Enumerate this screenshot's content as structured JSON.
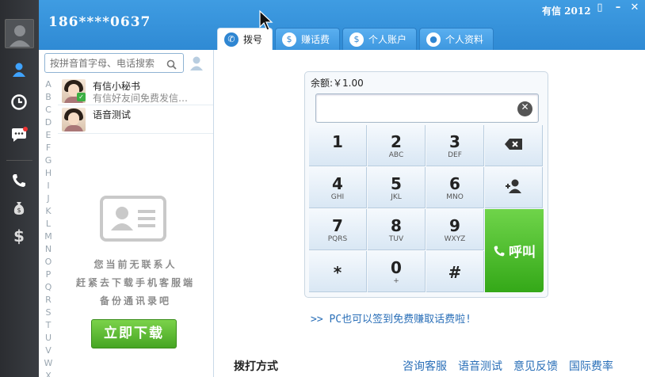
{
  "header": {
    "phone": "186****0637",
    "brand": "有信 2012"
  },
  "tabs": [
    {
      "label": "拨号",
      "icon": "phone-icon"
    },
    {
      "label": "赚话费",
      "icon": "money-bag-icon"
    },
    {
      "label": "个人账户",
      "icon": "dollar-icon"
    },
    {
      "label": "个人资料",
      "icon": "user-icon"
    }
  ],
  "sidebar_icons": [
    "contacts-icon",
    "history-icon",
    "message-icon",
    "call-icon",
    "money-bag-icon",
    "dollar-icon"
  ],
  "contacts": {
    "search_placeholder": "按拼音首字母、电话搜索",
    "alphabet": [
      "A",
      "B",
      "C",
      "D",
      "E",
      "F",
      "G",
      "H",
      "I",
      "J",
      "K",
      "L",
      "M",
      "N",
      "O",
      "P",
      "Q",
      "R",
      "S",
      "T",
      "U",
      "V",
      "W",
      "X"
    ],
    "items": [
      {
        "name": "有信小秘书",
        "desc": "有信好友间免费发信…"
      },
      {
        "name": "语音测试",
        "desc": ""
      }
    ],
    "empty_lines": [
      "您当前无联系人",
      "赶紧去下载手机客服端",
      "备份通讯录吧"
    ],
    "download_label": "立即下载"
  },
  "dialer": {
    "balance": "余额:￥1.00",
    "number_value": "",
    "keys": [
      {
        "digit": "1",
        "letters": ""
      },
      {
        "digit": "2",
        "letters": "ABC"
      },
      {
        "digit": "3",
        "letters": "DEF"
      },
      {
        "digit": "4",
        "letters": "GHI"
      },
      {
        "digit": "5",
        "letters": "JKL"
      },
      {
        "digit": "6",
        "letters": "MNO"
      },
      {
        "digit": "7",
        "letters": "PQRS"
      },
      {
        "digit": "8",
        "letters": "TUV"
      },
      {
        "digit": "9",
        "letters": "WXYZ"
      },
      {
        "digit": "*",
        "letters": ""
      },
      {
        "digit": "0",
        "letters": "+"
      },
      {
        "digit": "#",
        "letters": ""
      }
    ],
    "call_label": "呼叫",
    "promo": ">> PC也可以签到免费赚取话费啦!"
  },
  "footer": {
    "title": "拨打方式",
    "links": [
      "咨询客服",
      "语音测试",
      "意见反馈",
      "国际费率"
    ]
  },
  "colors": {
    "header": "#3f9ce2",
    "sidebar": "#2b2d31",
    "call": "#46b024",
    "link": "#2a6fb8"
  }
}
